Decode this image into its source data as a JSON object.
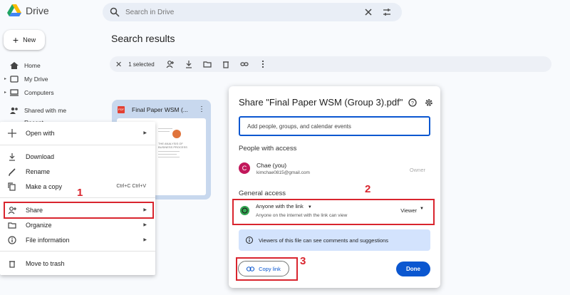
{
  "header": {
    "app_name": "Drive",
    "search_placeholder": "Search in Drive"
  },
  "sidebar": {
    "new_label": "New",
    "items": [
      {
        "label": "Home"
      },
      {
        "label": "My Drive"
      },
      {
        "label": "Computers"
      }
    ],
    "shared_label": "Shared with me",
    "recent_label": "Recent"
  },
  "main": {
    "title": "Search results",
    "selection": {
      "count_text": "1 selected"
    },
    "file": {
      "name": "Final Paper WSM (...",
      "thumb_lines": [
        "THE ANALYSIS OF",
        "BUSINESS PROCESS"
      ]
    }
  },
  "context_menu": {
    "items": [
      {
        "label": "Open with"
      },
      {
        "label": "Download"
      },
      {
        "label": "Rename"
      },
      {
        "label": "Make a copy",
        "shortcut": "Ctrl+C Ctrl+V"
      },
      {
        "label": "Share"
      },
      {
        "label": "Organize"
      },
      {
        "label": "File information"
      },
      {
        "label": "Move to trash"
      }
    ]
  },
  "dialog": {
    "title": "Share \"Final Paper WSM (Group 3).pdf\"",
    "add_placeholder": "Add people, groups, and calendar events",
    "people_heading": "People with access",
    "person": {
      "initial": "C",
      "name": "Chae (you)",
      "email": "kimchae0815@gmail.com",
      "role": "Owner"
    },
    "general_heading": "General access",
    "access": {
      "title": "Anyone with the link",
      "subtitle": "Anyone on the internet with the link can view",
      "role": "Viewer"
    },
    "info_text": "Viewers of this file can see comments and suggestions",
    "copy_link_label": "Copy link",
    "done_label": "Done"
  },
  "annotations": {
    "n1": "1",
    "n2": "2",
    "n3": "3"
  },
  "colors": {
    "accent": "#0b57d0",
    "callout": "#d9252e"
  }
}
